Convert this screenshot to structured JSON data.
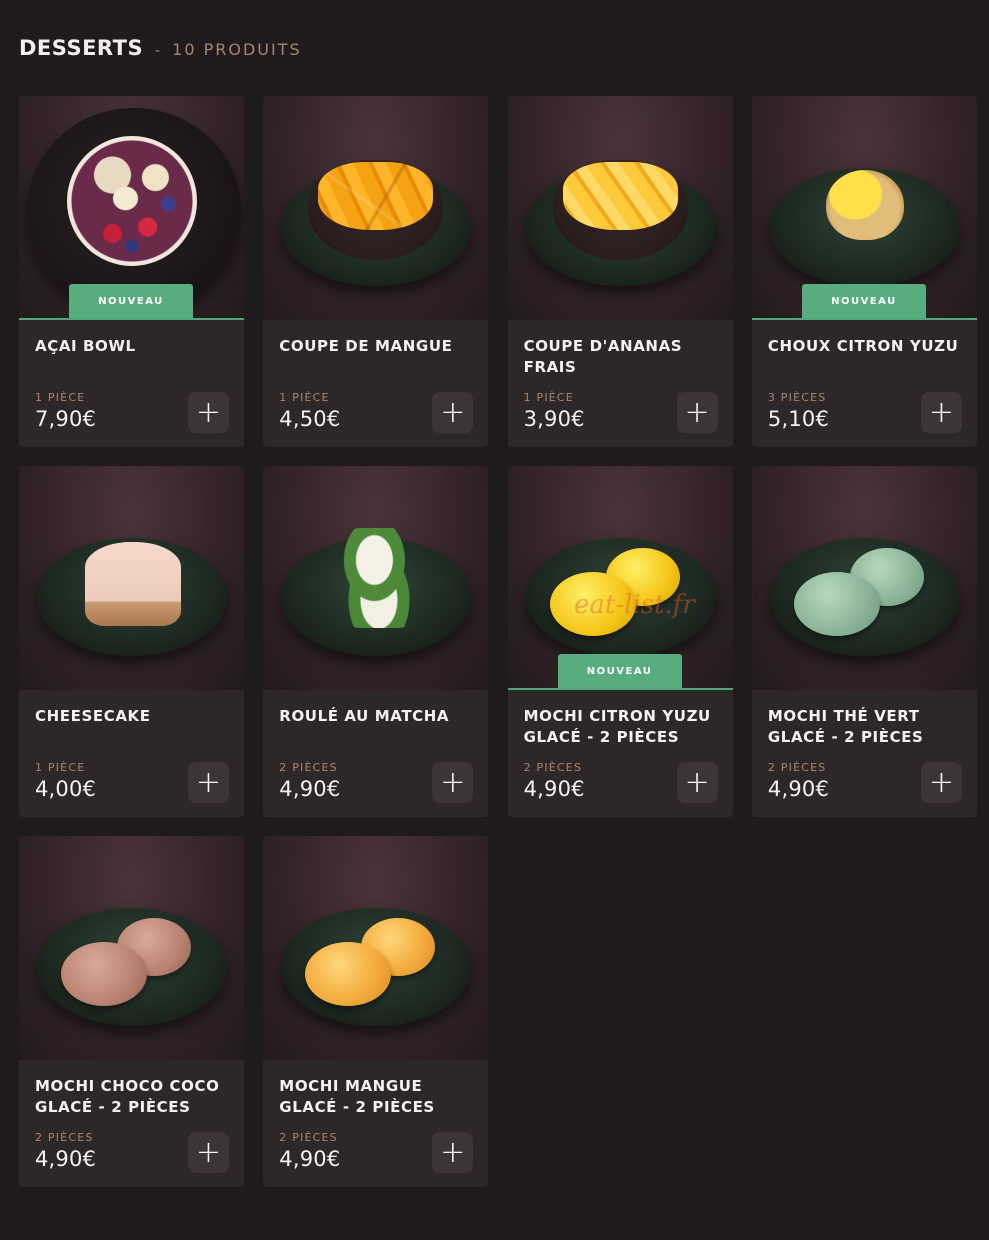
{
  "header": {
    "title": "DESSERTS",
    "separator": "-",
    "count": "10 PRODUITS"
  },
  "badge_label": "NOUVEAU",
  "add_label": "+",
  "watermark": "eat-list.fr",
  "colors": {
    "background": "#1f1a1d",
    "card": "#2e2729",
    "accent_green": "#57ad7e",
    "muted_text": "#a88570"
  },
  "products": [
    {
      "name": "AÇAI BOWL",
      "qty": "1 PIÈCE",
      "price": "7,90€",
      "is_new": true,
      "image": "acai-bowl"
    },
    {
      "name": "COUPE DE MANGUE",
      "qty": "1 PIÈCE",
      "price": "4,50€",
      "is_new": false,
      "image": "mango-cup"
    },
    {
      "name": "COUPE D'ANANAS FRAIS",
      "qty": "1 PIÈCE",
      "price": "3,90€",
      "is_new": false,
      "image": "pineapple-cup"
    },
    {
      "name": "CHOUX CITRON YUZU",
      "qty": "3 PIÈCES",
      "price": "5,10€",
      "is_new": true,
      "image": "choux"
    },
    {
      "name": "CHEESECAKE",
      "qty": "1 PIÈCE",
      "price": "4,00€",
      "is_new": false,
      "image": "cheesecake"
    },
    {
      "name": "ROULÉ AU MATCHA",
      "qty": "2 PIÈCES",
      "price": "4,90€",
      "is_new": false,
      "image": "matcha-roll"
    },
    {
      "name": "MOCHI CITRON YUZU GLACÉ - 2 PIÈCES",
      "qty": "2 PIÈCES",
      "price": "4,90€",
      "is_new": true,
      "image": "mochi-yellow"
    },
    {
      "name": "MOCHI THÉ VERT GLACÉ - 2 PIÈCES",
      "qty": "2 PIÈCES",
      "price": "4,90€",
      "is_new": false,
      "image": "mochi-green"
    },
    {
      "name": "MOCHI CHOCO COCO GLACÉ - 2 PIÈCES",
      "qty": "2 PIÈCES",
      "price": "4,90€",
      "is_new": false,
      "image": "mochi-choco"
    },
    {
      "name": "MOCHI MANGUE GLACÉ - 2 PIÈCES",
      "qty": "2 PIÈCES",
      "price": "4,90€",
      "is_new": false,
      "image": "mochi-mango"
    }
  ]
}
